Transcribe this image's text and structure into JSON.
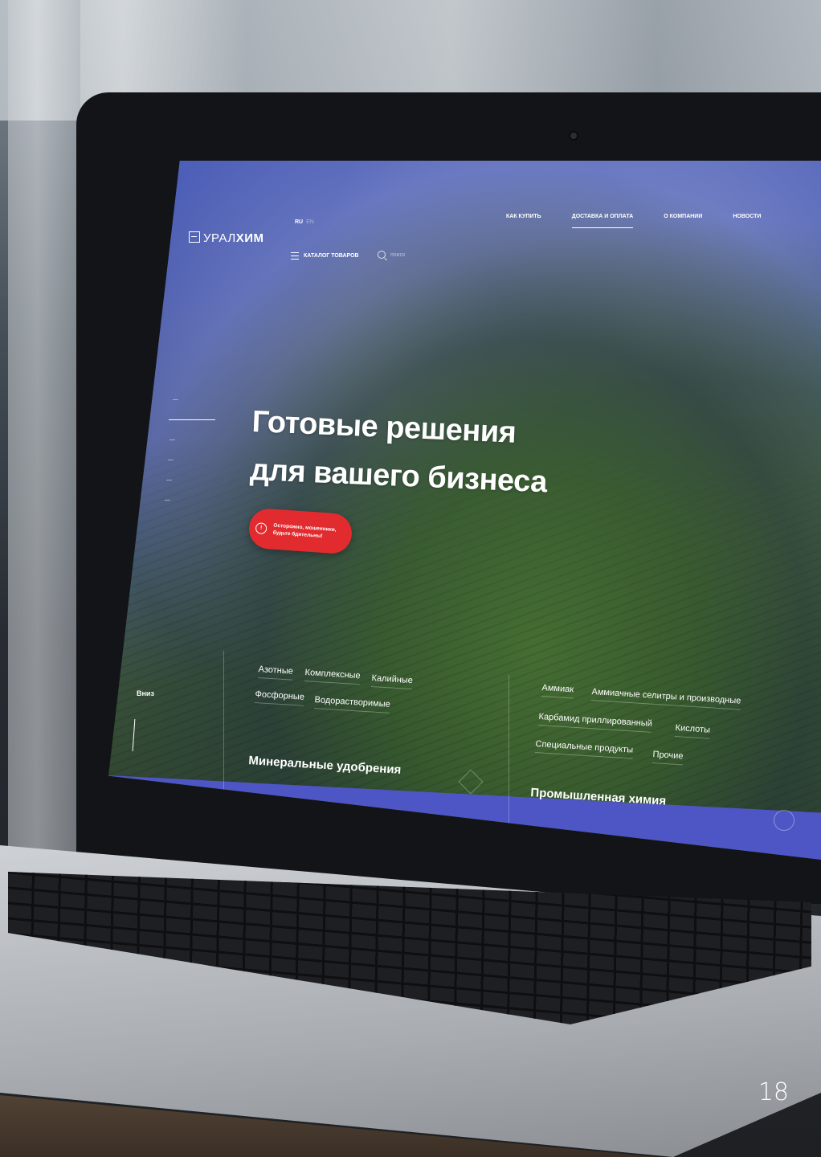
{
  "site": {
    "logo_light": "УРАЛ",
    "logo_bold": "ХИМ",
    "lang_active": "RU",
    "lang_other": "EN"
  },
  "nav": {
    "items": [
      {
        "label": "КАК КУПИТЬ",
        "active": false
      },
      {
        "label": "ДОСТАВКА И ОПЛАТА",
        "active": true
      },
      {
        "label": "О КОМПАНИИ",
        "active": false
      },
      {
        "label": "НОВОСТИ",
        "active": false
      }
    ],
    "catalog_label": "КАТАЛОГ ТОВАРОВ",
    "search_placeholder": "поиск"
  },
  "hero": {
    "title_line1": "Готовые решения",
    "title_line2": "для вашего бизнеса",
    "warning_line1": "Осторожно, мошенники,",
    "warning_line2": "будьте бдительны!",
    "scroll_label": "Вниз"
  },
  "categories": {
    "fertilizers": {
      "title": "Минеральные удобрения",
      "items": [
        "Азотные",
        "Комплексные",
        "Калийные",
        "Фосфорные",
        "Водорастворимые"
      ]
    },
    "chemistry": {
      "title": "Промышленная химия",
      "items": [
        "Аммиак",
        "Аммиачные селитры и производные",
        "Карбамид приллированный",
        "Кислоты",
        "Специальные продукты",
        "Прочие"
      ]
    }
  },
  "page_number": "18",
  "colors": {
    "header_blue": "#4e56c6",
    "warning_red": "#e22b2f"
  }
}
